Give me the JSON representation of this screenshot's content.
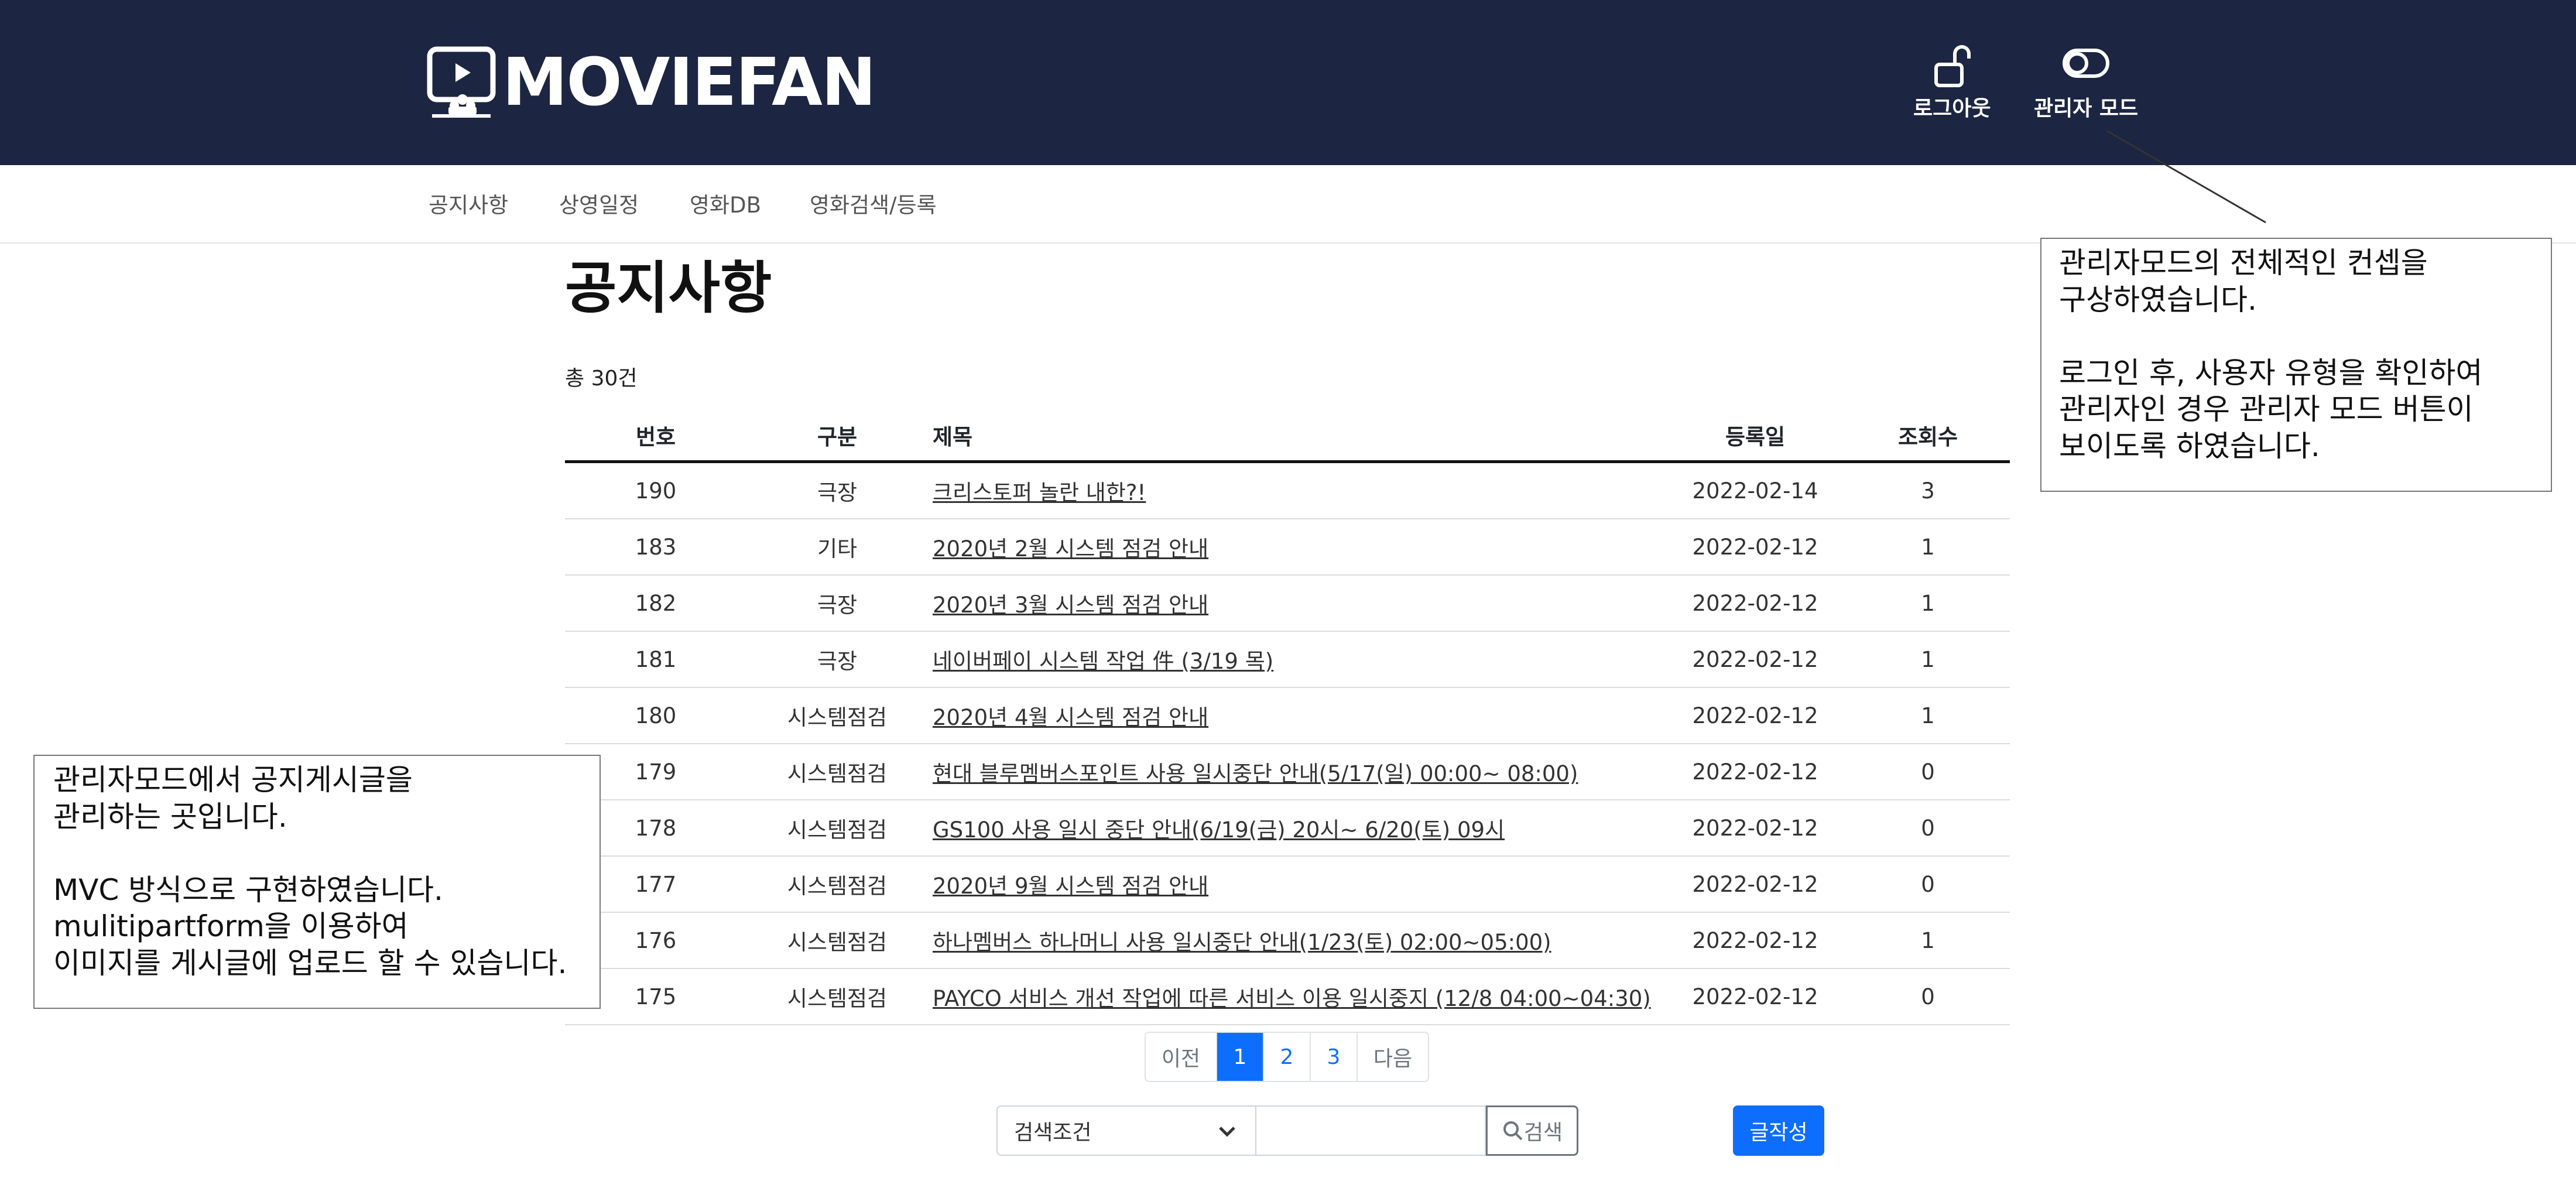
{
  "header": {
    "logo_text": "MOVIEFAN",
    "logout_label": "로그아웃",
    "admin_mode_label": "관리자 모드",
    "logout_icon": "unlock-icon",
    "admin_mode_icon": "toggle-icon"
  },
  "nav": {
    "items": [
      "공지사항",
      "상영일정",
      "영화DB",
      "영화검색/등록"
    ]
  },
  "main": {
    "title": "공지사항",
    "total": "총 30건"
  },
  "table": {
    "headers": [
      "번호",
      "구분",
      "제목",
      "등록일",
      "조회수"
    ],
    "rows": [
      {
        "num": "190",
        "category": "극장",
        "title": "크리스토퍼 놀란 내한?!",
        "date": "2022-02-14",
        "views": "3"
      },
      {
        "num": "183",
        "category": "기타",
        "title": "2020년 2월 시스템 점검 안내",
        "date": "2022-02-12",
        "views": "1"
      },
      {
        "num": "182",
        "category": "극장",
        "title": "2020년 3월 시스템 점검 안내",
        "date": "2022-02-12",
        "views": "1"
      },
      {
        "num": "181",
        "category": "극장",
        "title": "네이버페이 시스템 작업 件 (3/19 목)",
        "date": "2022-02-12",
        "views": "1"
      },
      {
        "num": "180",
        "category": "시스템점검",
        "title": "2020년 4월 시스템 점검 안내",
        "date": "2022-02-12",
        "views": "1"
      },
      {
        "num": "179",
        "category": "시스템점검",
        "title": "현대 블루멤버스포인트 사용 일시중단 안내(5/17(일) 00:00~ 08:00)",
        "date": "2022-02-12",
        "views": "0"
      },
      {
        "num": "178",
        "category": "시스템점검",
        "title": "GS100 사용 일시 중단 안내(6/19(금) 20시~ 6/20(토) 09시",
        "date": "2022-02-12",
        "views": "0"
      },
      {
        "num": "177",
        "category": "시스템점검",
        "title": "2020년 9월 시스템 점검 안내",
        "date": "2022-02-12",
        "views": "0"
      },
      {
        "num": "176",
        "category": "시스템점검",
        "title": "하나멤버스 하나머니 사용 일시중단 안내(1/23(토) 02:00~05:00)",
        "date": "2022-02-12",
        "views": "1"
      },
      {
        "num": "175",
        "category": "시스템점검",
        "title": "PAYCO 서비스 개선 작업에 따른 서비스 이용 일시중지 (12/8 04:00~04:30)",
        "date": "2022-02-12",
        "views": "0"
      }
    ]
  },
  "pagination": {
    "prev": "이전",
    "pages": [
      "1",
      "2",
      "3"
    ],
    "current": "1",
    "next": "다음"
  },
  "search": {
    "condition_label": "검색조건",
    "query": "",
    "button_label": "검색",
    "write_label": "글작성"
  },
  "annotations": {
    "right_note": "관리자모드의 전체적인 컨셉을\n구상하였습니다.\n\n로그인 후, 사용자 유형을 확인하여\n관리자인 경우 관리자 모드 버튼이\n보이도록 하였습니다.",
    "left_note": "관리자모드에서 공지게시글을\n관리하는 곳입니다.\n\nMVC 방식으로 구현하였습니다.\nmulitipartform을 이용하여\n이미지를 게시글에 업로드 할 수 있습니다."
  },
  "colors": {
    "header_bg": "#1c2541",
    "primary": "#0d6efd"
  }
}
